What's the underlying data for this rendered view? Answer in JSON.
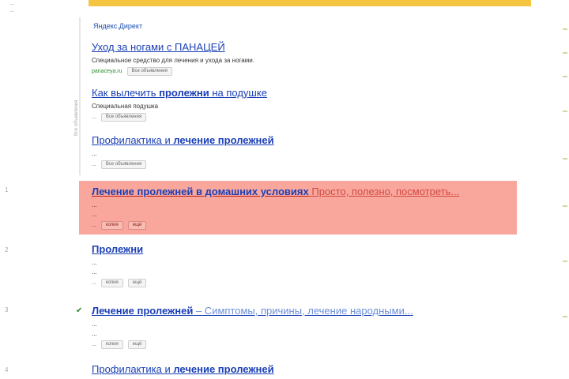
{
  "topleft": {
    "line1": "...",
    "line2": "..."
  },
  "ad_header": "Яндекс.Директ",
  "ad_vertical": "Все объявления",
  "ads": [
    {
      "title": "Уход за ногами с ПАНАЦЕЙ",
      "snippet": "Специальное средство для лечения и ухода за ногами.",
      "url": "panaceya.ru",
      "btn": "Все объявления"
    },
    {
      "title_pre": "Как вылечить ",
      "title_bold": "пролежни",
      "title_post": " на подушке",
      "snippet": "Специальная подушка",
      "url": "...",
      "btn": "Все объявления"
    },
    {
      "title_pre": "Профилактика и ",
      "title_bold": "лечение пролежней",
      "title_post": "",
      "snippet": "...",
      "url": "...",
      "btn": "Все объявления"
    }
  ],
  "results": [
    {
      "num": "1",
      "title_bold": "Лечение пролежней в домашних условиях",
      "title_extra": " Просто, полезно, посмотреть...",
      "snippet1": "...",
      "snippet2": "...",
      "url": "...",
      "btn1": "копия",
      "btn2": "ещё"
    },
    {
      "num": "2",
      "title_bold": "Пролежни",
      "snippet1": "...",
      "snippet2": "...",
      "url": "...",
      "btn1": "копия",
      "btn2": "ещё"
    },
    {
      "num": "3",
      "title_bold": "Лечение пролежней",
      "title_extra": " – Симптомы, причины, лечение народными...",
      "snippet1": "...",
      "snippet2": "...",
      "url": "...",
      "btn1": "копия",
      "btn2": "ещё"
    },
    {
      "num": "4",
      "title_pre": "Профилактика и ",
      "title_bold": "лечение пролежней"
    }
  ],
  "colors": {
    "topbar": "#f5c542",
    "highlight": "#f9a79d",
    "link": "#1a3fb5",
    "url": "#2a8a2a"
  }
}
